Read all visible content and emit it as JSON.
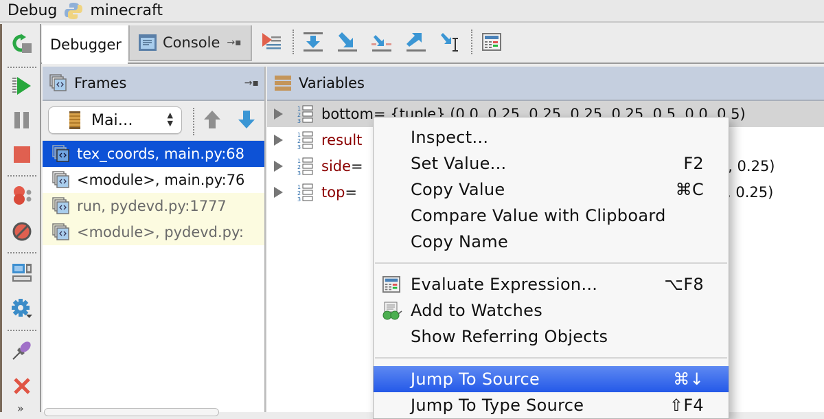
{
  "titlebar": {
    "label": "Debug",
    "config_name": "minecraft",
    "config_icon": "python-icon"
  },
  "left_toolbar": {
    "buttons": [
      {
        "name": "rerun-icon",
        "tooltip": "Rerun"
      },
      {
        "name": "resume-icon",
        "tooltip": "Resume Program"
      },
      {
        "name": "pause-icon",
        "tooltip": "Pause Program"
      },
      {
        "name": "stop-icon",
        "tooltip": "Stop"
      },
      {
        "name": "view-breakpoints-icon",
        "tooltip": "View Breakpoints"
      },
      {
        "name": "mute-breakpoints-icon",
        "tooltip": "Mute Breakpoints"
      },
      {
        "name": "restore-layout-icon",
        "tooltip": "Restore Layout"
      },
      {
        "name": "settings-icon",
        "tooltip": "Settings"
      },
      {
        "name": "pin-tab-icon",
        "tooltip": "Pin Tab"
      },
      {
        "name": "close-icon",
        "tooltip": "Close"
      }
    ],
    "more_label": "»"
  },
  "tabs": [
    {
      "label": "Debugger",
      "active": true
    },
    {
      "label": "Console",
      "active": false,
      "pin_glyph": "→▪"
    }
  ],
  "debug_toolbar": [
    "show-execution-point-icon",
    "step-over-icon",
    "step-into-icon",
    "step-into-my-code-icon",
    "step-out-icon",
    "run-to-cursor-icon",
    "evaluate-expression-icon"
  ],
  "frames": {
    "title": "Frames",
    "pin_glyph": "→▪",
    "thread_selector": {
      "value": "Mai…",
      "arrows": "▲▼"
    },
    "items": [
      {
        "label": "tex_coords, main.py:68",
        "selected": true,
        "library": false
      },
      {
        "label": "<module>, main.py:76",
        "selected": false,
        "library": false
      },
      {
        "label": "run, pydevd.py:1777",
        "selected": false,
        "library": true
      },
      {
        "label": "<module>, pydevd.py:",
        "selected": false,
        "library": true
      }
    ]
  },
  "variables": {
    "title": "Variables",
    "items": [
      {
        "name": "bottom",
        "rest": " = {tuple} (0.0, 0.25, 0.25, 0.25, 0.25, 0.5, 0.0, 0.5)",
        "visible_tail": ", 0.0, 0.5)",
        "selected": true
      },
      {
        "name": "result",
        "rest": "",
        "visible_tail": "",
        "selected": false
      },
      {
        "name": "side",
        "rest": " =",
        "visible_tail": "), 0.25)",
        "selected": false
      },
      {
        "name": "top",
        "rest": " =",
        "visible_tail": ", 0.25)",
        "selected": false
      }
    ]
  },
  "context_menu": {
    "groups": [
      [
        {
          "label": "Inspect...",
          "shortcut": ""
        },
        {
          "label": "Set Value...",
          "shortcut": "F2"
        },
        {
          "label": "Copy Value",
          "shortcut": "⌘C"
        },
        {
          "label": "Compare Value with Clipboard",
          "shortcut": ""
        },
        {
          "label": "Copy Name",
          "shortcut": ""
        }
      ],
      [
        {
          "label": "Evaluate Expression...",
          "shortcut": "⌥F8",
          "icon": "evaluate-expression-icon"
        },
        {
          "label": "Add to Watches",
          "shortcut": "",
          "icon": "watches-icon"
        },
        {
          "label": "Show Referring Objects",
          "shortcut": ""
        }
      ],
      [
        {
          "label": "Jump To Source",
          "shortcut": "⌘↓",
          "highlighted": true
        },
        {
          "label": "Jump To Type Source",
          "shortcut": "⇧F4"
        }
      ]
    ]
  },
  "colors": {
    "selection_blue": "#0d52d6",
    "menu_highlight": "#2e62ea",
    "panel_header": "#c5cfdf",
    "variable_name": "#8b0000",
    "library_frame_bg": "#fcfbe0"
  }
}
